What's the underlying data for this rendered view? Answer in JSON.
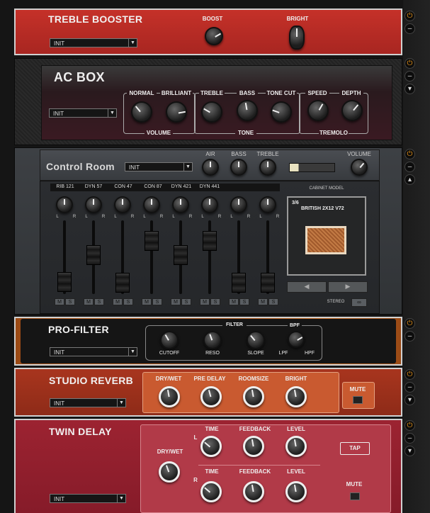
{
  "treble_booster": {
    "title": "TREBLE BOOSTER",
    "preset": "INIT",
    "boost_label": "BOOST",
    "bright_label": "BRIGHT"
  },
  "ac_box": {
    "title": "AC BOX",
    "preset": "INIT",
    "knob_labels": [
      "NORMAL",
      "BRILLIANT",
      "TREBLE",
      "BASS",
      "TONE CUT",
      "SPEED",
      "DEPTH"
    ],
    "group_labels": [
      "VOLUME",
      "TONE",
      "TREMOLO"
    ]
  },
  "control_room": {
    "title": "Control Room",
    "preset": "INIT",
    "air_label": "AIR",
    "bass_label": "BASS",
    "treble_label": "TREBLE",
    "volume_label": "VOLUME",
    "channels": [
      "RIB 121",
      "DYN 57",
      "CON 47",
      "CON 87",
      "DYN 421",
      "DYN 441"
    ],
    "pan_l": "L",
    "pan_r": "R",
    "mute": "M",
    "solo": "S",
    "cabinet_model_label": "CABINET MODEL",
    "cabinet_count": "3/6",
    "cabinet_name": "BRITISH 2X12 V72",
    "stereo_label": "STEREO",
    "prev_icon": "left-arrow-icon",
    "next_icon": "right-arrow-icon"
  },
  "pro_filter": {
    "title": "PRO-FILTER",
    "preset": "INIT",
    "filter_label": "FILTER",
    "bpf_label": "BPF",
    "knob_labels": [
      "CUTOFF",
      "RESO",
      "SLOPE"
    ],
    "lpf": "LPF",
    "hpf": "HPF"
  },
  "studio_reverb": {
    "title": "STUDIO REVERB",
    "preset": "INIT",
    "knob_labels": [
      "DRY/WET",
      "PRE DELAY",
      "ROOMSIZE",
      "BRIGHT"
    ],
    "mute_label": "MUTE"
  },
  "twin_delay": {
    "title": "TWIN DELAY",
    "preset": "INIT",
    "drywet_label": "DRY/WET",
    "l": "L",
    "r": "R",
    "row_labels": [
      "TIME",
      "FEEDBACK",
      "LEVEL"
    ],
    "tap_label": "TAP",
    "mute_label": "MUTE"
  },
  "side_controls": {
    "power_icon": "power-icon",
    "minus_icon": "minus-icon",
    "down_icon": "down-arrow-icon",
    "up_icon": "up-arrow-icon"
  },
  "colors": {
    "power_orange": "#f39a1a",
    "treble_red": "#b52a24",
    "reverb_orange": "#a8351e",
    "delay_red": "#9c2331",
    "wood": "#b45a1a"
  }
}
